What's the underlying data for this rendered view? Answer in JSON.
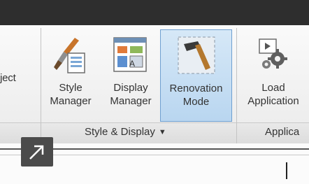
{
  "ribbon": {
    "partial_tool_label": "ject",
    "tools": [
      {
        "line1": "Style",
        "line2": "Manager",
        "icon": "style-manager-icon"
      },
      {
        "line1": "Display",
        "line2": "Manager",
        "icon": "display-manager-icon"
      },
      {
        "line1": "Renovation",
        "line2": "Mode",
        "icon": "renovation-mode-icon",
        "active": true
      },
      {
        "line1": "Load",
        "line2": "Application",
        "icon": "load-application-icon"
      }
    ],
    "panels": [
      {
        "title": "Style & Display",
        "has_dropdown": true
      },
      {
        "title": "Applica"
      }
    ]
  },
  "colors": {
    "active_fill": "#c7def3",
    "active_border": "#6fa0d1",
    "titlebar": "#2e2e2e"
  }
}
